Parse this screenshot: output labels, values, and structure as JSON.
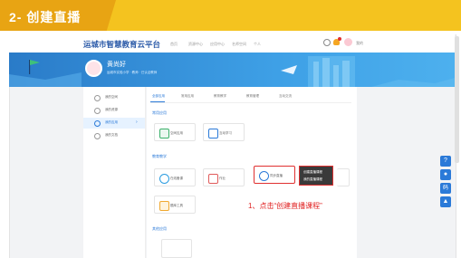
{
  "slide": {
    "title": "2- 创建直播"
  },
  "app": {
    "logo": "运城市智慧教育云平台",
    "nav": [
      "首页",
      "资源中心",
      "应用中心",
      "名师空间",
      "个人"
    ],
    "notification_count": "",
    "user_short": "我的"
  },
  "profile": {
    "name": "黄尚好",
    "school": "运城市实验小学 · 教师 · 已认证教师"
  },
  "sidebar": {
    "items": [
      {
        "label": "我的空间",
        "active": false
      },
      {
        "label": "我的资源",
        "active": false
      },
      {
        "label": "我的应用",
        "active": true
      },
      {
        "label": "我的文档",
        "active": false
      }
    ]
  },
  "tabs": [
    "全部应用",
    "常用应用",
    "教育教学",
    "教育管理",
    "互动交流"
  ],
  "sections": {
    "common": {
      "title": "常用应用",
      "cards": [
        "空间应用",
        "互动学习"
      ]
    },
    "teaching": {
      "title": "教育教学",
      "cards": [
        "在线备课",
        "作业",
        "同步直播",
        "题库工具"
      ]
    },
    "other": {
      "title": "其他应用"
    }
  },
  "dropdown": {
    "items": [
      "创建直播课程",
      "我的直播课程"
    ]
  },
  "annotation": "1、点击“创建直播课程”",
  "floating_buttons": [
    "?",
    "●",
    "码",
    "▲"
  ],
  "colors": {
    "accent": "#2b7ad8",
    "header": "#f4c31f",
    "highlight": "#e03030"
  }
}
